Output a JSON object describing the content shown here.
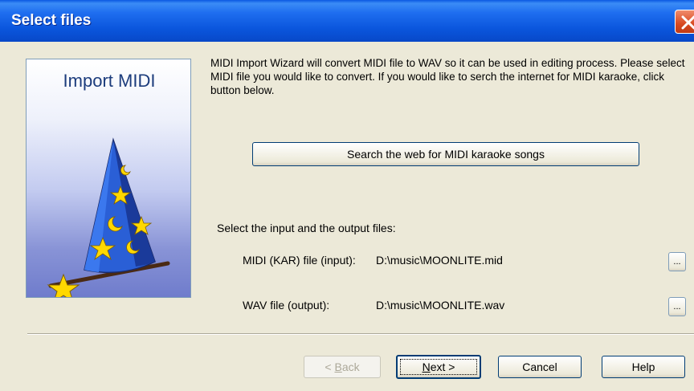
{
  "window": {
    "title": "Select files",
    "close_icon": "close-icon"
  },
  "banner": {
    "title": "Import MIDI",
    "image": "wizard-hat-icon"
  },
  "description": "MIDI Import Wizard will convert MIDI file to WAV so it can be used in editing process. Please select MIDI file you would like to convert. If you would like to serch the internet for MIDI karaoke, click button below.",
  "web_search_button": "Search the web for MIDI karaoke songs",
  "files": {
    "heading": "Select the input and the output files:",
    "input": {
      "label": "MIDI (KAR) file (input):",
      "value": "D:\\music\\MOONLITE.mid",
      "browse": "..."
    },
    "output": {
      "label": "WAV file (output):",
      "value": "D:\\music\\MOONLITE.wav",
      "browse": "..."
    }
  },
  "buttons": {
    "back_prefix": "< ",
    "back_key": "B",
    "back_rest": "ack",
    "next_key": "N",
    "next_rest": "ext >",
    "cancel": "Cancel",
    "help": "Help"
  }
}
